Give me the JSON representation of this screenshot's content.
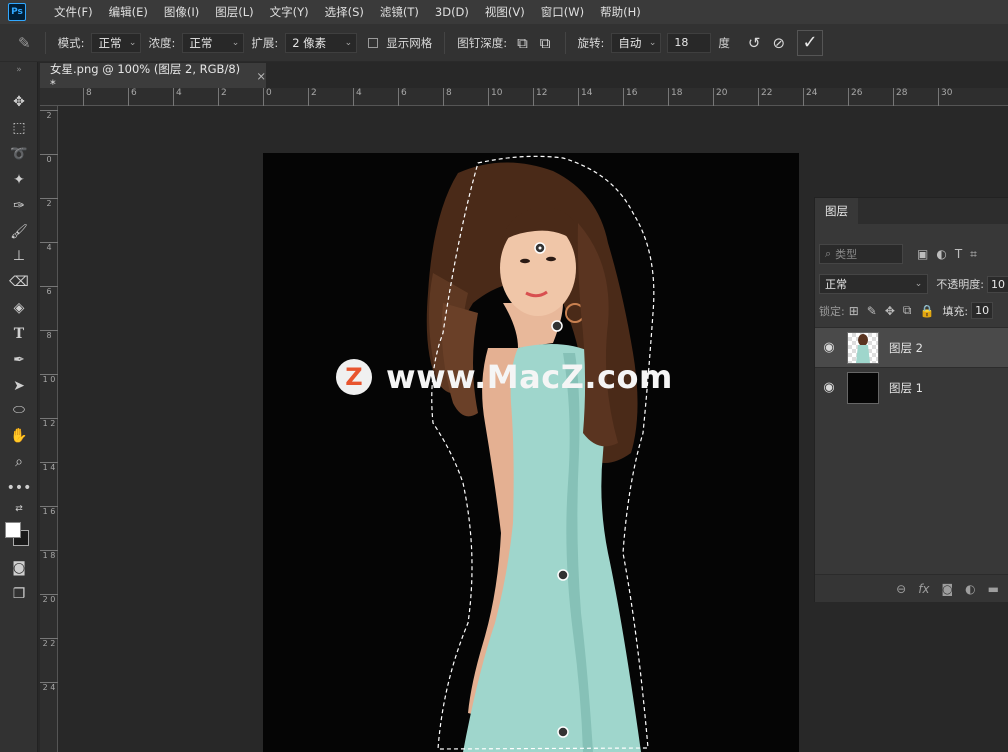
{
  "app": {
    "logo": "Ps"
  },
  "menu": [
    "文件(F)",
    "编辑(E)",
    "图像(I)",
    "图层(L)",
    "文字(Y)",
    "选择(S)",
    "滤镜(T)",
    "3D(D)",
    "视图(V)",
    "窗口(W)",
    "帮助(H)"
  ],
  "options": {
    "mode_label": "模式:",
    "mode_value": "正常",
    "density_label": "浓度:",
    "density_value": "正常",
    "expand_label": "扩展:",
    "expand_value": "2 像素",
    "show_mesh_label": "显示网格",
    "pin_depth_label": "图钉深度:",
    "rotate_label": "旋转:",
    "rotate_value": "自动",
    "angle_value": "18",
    "angle_unit": "度"
  },
  "document_tab": {
    "title": "女星.png @ 100% (图层 2, RGB/8) *",
    "close": "×"
  },
  "ruler": {
    "top": [
      "8",
      "6",
      "4",
      "2",
      "0",
      "2",
      "4",
      "6",
      "8",
      "10",
      "12",
      "14",
      "16",
      "18",
      "20",
      "22",
      "24",
      "26",
      "28",
      "30"
    ],
    "left": [
      "2",
      "0",
      "2",
      "4",
      "6",
      "8",
      "1 0",
      "1 2",
      "1 4",
      "1 6",
      "1 8",
      "2 0",
      "2 2",
      "2 4"
    ]
  },
  "watermark": {
    "logo_letter": "Z",
    "text": "www.MacZ.com"
  },
  "layers_panel": {
    "tab": "图层",
    "filter_placeholder": "类型",
    "blend_mode": "正常",
    "opacity_label": "不透明度:",
    "opacity_value": "10",
    "lock_label": "锁定:",
    "fill_label": "填充:",
    "fill_value": "10",
    "layers": [
      {
        "name": "图层 2",
        "selected": true
      },
      {
        "name": "图层 1",
        "selected": false
      }
    ]
  },
  "colors": {
    "accent": "#31a8ff",
    "canvas_bg": "#050505",
    "dress": "#9fd6cc",
    "hair": "#5a3420"
  }
}
